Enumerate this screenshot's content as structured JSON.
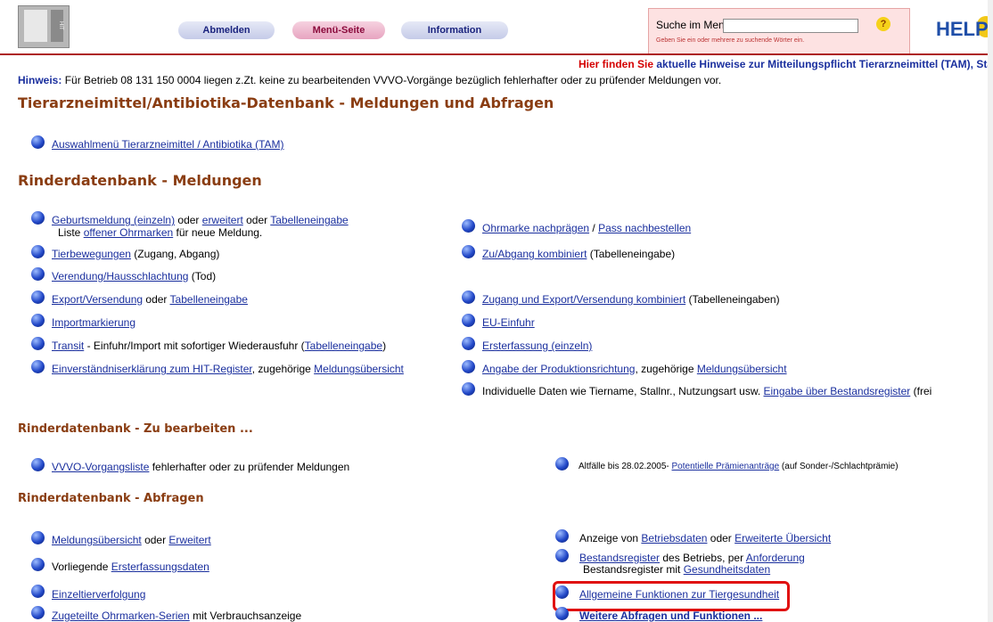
{
  "header": {
    "logo_alt": "HIT",
    "nav": {
      "abmelden": "Abmelden",
      "menu": "Menü-Seite",
      "info": "Information"
    },
    "search": {
      "label": "Suche im Menü:",
      "value": "",
      "hint": "Geben Sie ein oder mehrere zu suchende Wörter ein.",
      "help_glyph": "?"
    },
    "help_logo": "HELP"
  },
  "notice": {
    "red": "Hier finden Sie",
    "blue": "aktuelle Hinweise zur Mitteilungspflicht Tierarzneimittel (TAM), Sta"
  },
  "hinweis": {
    "label": "Hinweis:",
    "text": "Für Betrieb 08 131 150 0004 liegen z.Zt. keine zu bearbeitenden VVVO-Vorgänge bezüglich fehlerhafter oder zu prüfender Meldungen vor."
  },
  "sections": {
    "tam_title": "Tierarzneimittel/Antibiotika-Datenbank - Meldungen und Abfragen",
    "tam_link": "Auswahlmenü Tierarzneimittel / Antibiotika (TAM)",
    "meld_title": "Rinderdatenbank - Meldungen",
    "bearb_title": "Rinderdatenbank - Zu bearbeiten ...",
    "abfr_title": "Rinderdatenbank - Abfragen"
  },
  "meldungen": {
    "geburt": {
      "l1": "Geburtsmeldung (einzeln)",
      "t1": " oder ",
      "l2": "erweitert",
      "t2": " oder ",
      "l3": "Tabelleneingabe",
      "sub1": "Liste ",
      "sub_link": "offener Ohrmarken",
      "sub2": " für neue Meldung."
    },
    "tierbew": {
      "link": "Tierbewegungen",
      "text": " (Zugang, Abgang)"
    },
    "verend": {
      "link": "Verendung/Hausschlachtung",
      "text": " (Tod)"
    },
    "export": {
      "l1": "Export/Versendung",
      "t1": " oder ",
      "l2": "Tabelleneingabe"
    },
    "import": {
      "link": "Importmarkierung"
    },
    "transit": {
      "link": "Transit",
      "text": " - Einfuhr/Import mit sofortiger Wiederausfuhr (",
      "l2": "Tabelleneingabe",
      "t2": ")"
    },
    "einv": {
      "link": "Einverständniserklärung zum HIT-Register",
      "text": ", zugehörige ",
      "l2": "Meldungsübersicht"
    },
    "ohrmarke": {
      "l1": "Ohrmarke nachprägen",
      "t1": " / ",
      "l2": "Pass nachbestellen"
    },
    "zuab": {
      "link": "Zu/Abgang kombiniert",
      "text": " (Tabelleneingabe)"
    },
    "zugexp": {
      "link": "Zugang und Export/Versendung kombiniert",
      "text": " (Tabelleneingaben)"
    },
    "eu": {
      "link": "EU-Einfuhr"
    },
    "erst": {
      "link": "Ersterfassung (einzeln)"
    },
    "prod": {
      "link": "Angabe der Produktionsrichtung",
      "text": ", zugehörige ",
      "l2": "Meldungsübersicht"
    },
    "indiv": {
      "text": "Individuelle Daten wie Tiername, Stallnr., Nutzungsart usw. ",
      "link": "Eingabe über Bestandsregister",
      "t2": " (frei"
    }
  },
  "bearbeiten": {
    "vvvo": {
      "link": "VVVO-Vorgangsliste",
      "text": " fehlerhafter oder zu prüfender Meldungen"
    },
    "altf": {
      "text": "Altfälle bis 28.02.2005- ",
      "link": "Potentielle Prämienanträge",
      "t2": " (auf Sonder-/Schlachtprämie)"
    }
  },
  "abfragen": {
    "meldueb": {
      "l1": "Meldungsübersicht",
      "t1": " oder ",
      "l2": "Erweitert"
    },
    "vorlieg": {
      "text": "Vorliegende ",
      "link": "Ersterfassungsdaten"
    },
    "einzel": {
      "link": "Einzeltierverfolgung"
    },
    "zuget": {
      "link": "Zugeteilte Ohrmarken-Serien",
      "text": " mit Verbrauchsanzeige"
    },
    "anzeige": {
      "text": "Anzeige von ",
      "l1": "Betriebsdaten",
      "t1": " oder ",
      "l2": "Erweiterte Übersicht"
    },
    "bestand": {
      "l1": "Bestandsregister",
      "t1": " des Betriebs, per ",
      "l2": "Anforderung",
      "sub1": "Bestandsregister mit ",
      "sub_link": "Gesundheitsdaten"
    },
    "allg": {
      "link": "Allgemeine Funktionen zur Tiergesundheit"
    },
    "weitere": {
      "link": "Weitere Abfragen und Funktionen ..."
    }
  }
}
